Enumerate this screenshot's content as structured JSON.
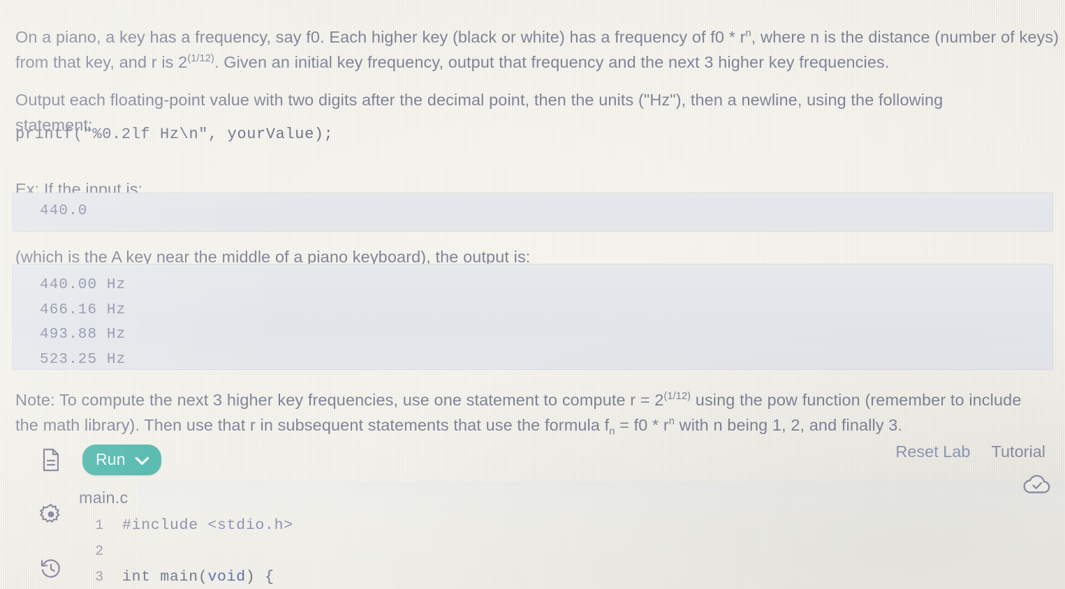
{
  "problem": {
    "intro_part1": "On a piano, a key has a frequency, say f0. Each higher key (black or white) has a frequency of f0 * r",
    "intro_sup1": "n",
    "intro_part2": ", where n is the distance (number of keys) from that key, and r is 2",
    "intro_sup2": "(1/12)",
    "intro_part3": ". Given an initial key frequency, output that frequency and the next 3 higher key frequencies.",
    "output_instruction": "Output each floating-point value with two digits after the decimal point, then the units (\"Hz\"), then a newline, using the following statement:",
    "printf_statement": "printf(\"%0.2lf Hz\\n\", yourValue);",
    "example_label": "Ex: If the input is:",
    "example_input": "440.0",
    "which_is_text": "(which is the A key near the middle of a piano keyboard), the output is:",
    "example_output": [
      "440.00 Hz",
      "466.16 Hz",
      "493.88 Hz",
      "523.25 Hz"
    ],
    "note_part1": "Note: To compute the next 3 higher key frequencies, use one statement to compute r = 2",
    "note_sup1": "(1/12)",
    "note_part2": " using the pow function (remember to include the math library). Then use that r in subsequent statements that use the formula f",
    "note_sub1": "n",
    "note_part3": " = f0 * r",
    "note_sup2": "n",
    "note_part4": " with n being 1, 2, and finally 3."
  },
  "lab": {
    "run_label": "Run",
    "run_color": "#4fb7ab",
    "reset_label": "Reset Lab",
    "tutorial_label": "Tutorial",
    "file_tab": "main.c",
    "rail_icons": [
      "document-icon",
      "gear-icon",
      "history-icon"
    ],
    "save_status_icon": "cloud-check-icon",
    "code_lines": [
      {
        "number": "1",
        "tokens": [
          {
            "text": "#include ",
            "cls": "pre"
          },
          {
            "text": "<stdio.h>",
            "cls": "hdr"
          }
        ]
      },
      {
        "number": "2",
        "tokens": []
      },
      {
        "number": "3",
        "tokens": [
          {
            "text": "int ",
            "cls": "fn"
          },
          {
            "text": "main",
            "cls": "fn"
          },
          {
            "text": "(",
            "cls": "fn"
          },
          {
            "text": "void",
            "cls": "kw"
          },
          {
            "text": ") {",
            "cls": "fn"
          }
        ]
      }
    ]
  }
}
